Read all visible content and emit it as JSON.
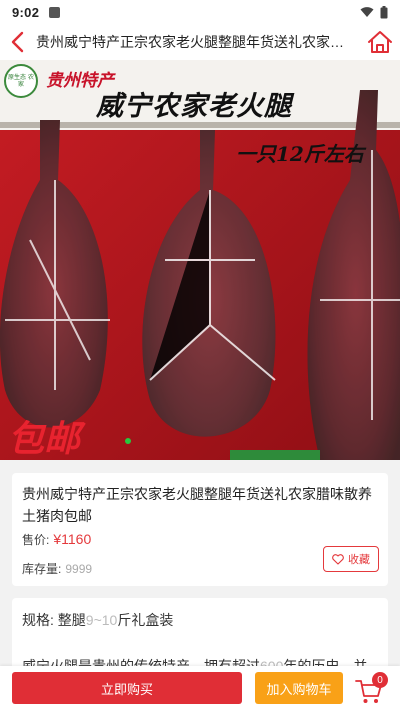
{
  "status_bar": {
    "time": "9:02"
  },
  "header": {
    "title": "贵州威宁特产正宗农家老火腿整腿年货送礼农家腊味散养土猪肉包邮"
  },
  "hero": {
    "banner_top": "贵州特产",
    "banner_main": "威宁农家老火腿",
    "banner_weight": "一只12斤左右",
    "banner_shipping": "包邮",
    "logo_text": "原生态 农家"
  },
  "product": {
    "name": "贵州威宁特产正宗农家老火腿整腿年货送礼农家腊味散养土猪肉包邮",
    "price_label": "售价:",
    "price": "¥1160",
    "stock_label": "库存量:",
    "stock": "9999",
    "favorite_label": "收藏"
  },
  "spec": {
    "label": "规格:",
    "value_a": "整腿",
    "value_b": "9~10",
    "value_c": "斤礼盒装",
    "description_a": "威宁火腿是贵州的传统特产，拥有超过",
    "description_b": "600",
    "description_c": "年的历史，并"
  },
  "bottom_bar": {
    "buy_label": "立即购买",
    "cart_label": "加入购物车",
    "cart_count": "0"
  },
  "colors": {
    "accent": "#e02e36",
    "cart_button": "#f9a117",
    "price": "#e4393c"
  },
  "icons": {
    "back": "chevron-left-icon",
    "home": "home-icon",
    "favorite": "heart-icon",
    "cart": "shopping-cart-icon"
  }
}
